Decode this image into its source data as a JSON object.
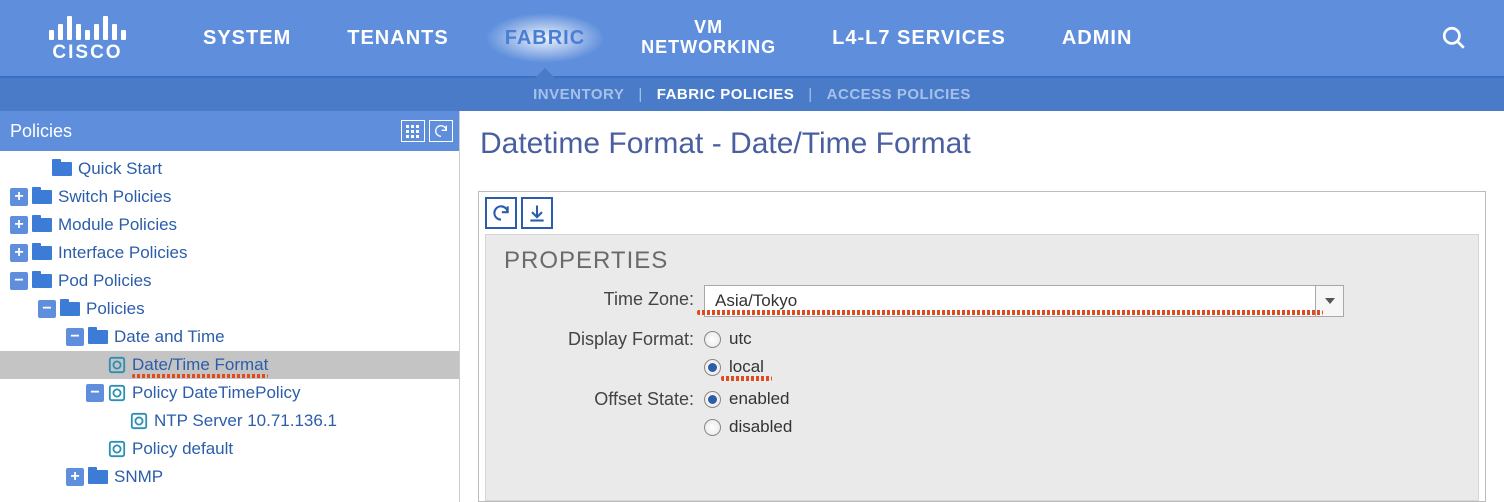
{
  "brand": "CISCO",
  "nav": {
    "items": [
      "SYSTEM",
      "TENANTS",
      "FABRIC",
      "VM NETWORKING",
      "L4-L7 SERVICES",
      "ADMIN"
    ],
    "active": "FABRIC"
  },
  "subnav": {
    "items": [
      {
        "label": "INVENTORY",
        "active": false
      },
      {
        "label": "FABRIC POLICIES",
        "active": true
      },
      {
        "label": "ACCESS POLICIES",
        "active": false
      }
    ]
  },
  "sidebar": {
    "title": "Policies",
    "tree": {
      "quick_start": "Quick Start",
      "switch_policies": "Switch Policies",
      "module_policies": "Module Policies",
      "interface_policies": "Interface Policies",
      "pod_policies": "Pod Policies",
      "policies": "Policies",
      "date_and_time": "Date and Time",
      "datetime_format": "Date/Time Format",
      "policy_datetimepolicy": "Policy DateTimePolicy",
      "ntp_server": "NTP Server 10.71.136.1",
      "policy_default": "Policy default",
      "snmp": "SNMP"
    }
  },
  "content": {
    "title": "Datetime Format - Date/Time Format",
    "properties_heading": "PROPERTIES",
    "fields": {
      "timezone": {
        "label": "Time Zone:",
        "value": "Asia/Tokyo"
      },
      "display_format": {
        "label": "Display Format:",
        "options": [
          "utc",
          "local"
        ],
        "selected": "local"
      },
      "offset_state": {
        "label": "Offset State:",
        "options": [
          "enabled",
          "disabled"
        ],
        "selected": "enabled"
      }
    }
  }
}
